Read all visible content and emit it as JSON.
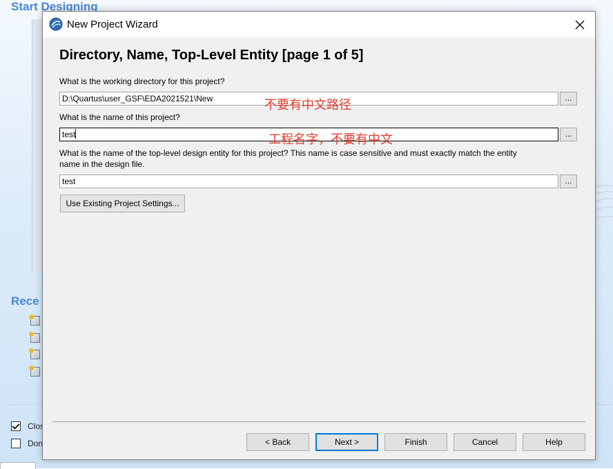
{
  "background": {
    "heading": "Start Designing",
    "recent_heading": "Rece",
    "checkboxes": [
      {
        "label": "Clos",
        "checked": true
      },
      {
        "label": "Don",
        "checked": false
      }
    ]
  },
  "dialog": {
    "title": "New Project Wizard",
    "heading": "Directory, Name, Top-Level Entity [page 1 of 5]",
    "fields": [
      {
        "prompt": "What is the working directory for this project?",
        "value": "D:\\Quartus\\user_GSF\\EDA2021521\\New",
        "annotation": "不要有中文路径"
      },
      {
        "prompt": "What is the name of this project?",
        "value": "test",
        "annotation": "工程名字，不要有中文"
      },
      {
        "prompt_line1": "What is the name of the top-level design entity for this project? This name is case sensitive and must exactly match the entity",
        "prompt_line2": "name in the design file.",
        "value": "test"
      }
    ],
    "browse_label": "...",
    "use_existing_label": "Use Existing Project Settings...",
    "buttons": {
      "back": "< Back",
      "next": "Next >",
      "finish": "Finish",
      "cancel": "Cancel",
      "help": "Help"
    }
  },
  "colors": {
    "annotation": "#e23b2c",
    "accent": "#0078d7",
    "background_heading": "#4a86d6"
  }
}
